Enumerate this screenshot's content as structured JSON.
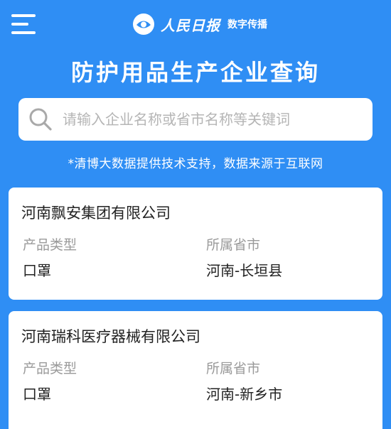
{
  "header": {
    "brand_name": "人民日报",
    "brand_sub": "数字传播",
    "icons": {
      "menu": "menu-icon",
      "logo": "people-daily-logo"
    }
  },
  "page": {
    "title": "防护用品生产企业查询"
  },
  "search": {
    "placeholder": "请输入企业名称或省市名称等关键词",
    "value": "",
    "icon": "search-icon"
  },
  "note": "*清博大数据提供技术支持，数据来源于互联网",
  "results": [
    {
      "company": "河南飘安集团有限公司",
      "product_label": "产品类型",
      "product": "口罩",
      "region_label": "所属省市",
      "region": "河南-长垣县"
    },
    {
      "company": "河南瑞科医疗器械有限公司",
      "product_label": "产品类型",
      "product": "口罩",
      "region_label": "所属省市",
      "region": "河南-新乡市"
    }
  ],
  "colors": {
    "background": "#2F8EF4",
    "card": "#FFFFFF",
    "label": "#9A9A9A",
    "text": "#222222"
  }
}
